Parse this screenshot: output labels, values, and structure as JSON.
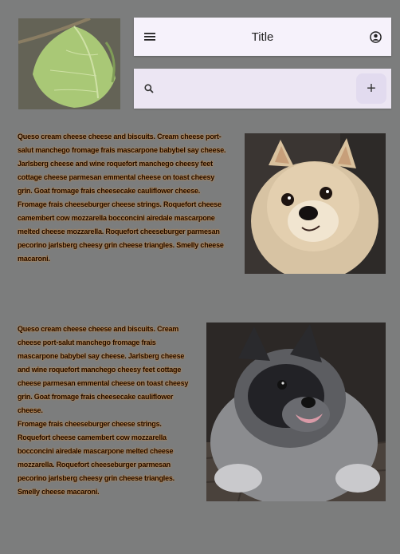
{
  "app_bar": {
    "title": "Title",
    "menu_icon": "menu-icon",
    "account_icon": "account-circle-icon"
  },
  "search": {
    "value": "",
    "placeholder": "",
    "search_icon": "search-icon",
    "add_label": "+"
  },
  "articles": [
    {
      "paragraphs": [
        "Queso cream cheese cheese and biscuits. Cream cheese port-salut manchego fromage frais mascarpone babybel say cheese. Jarlsberg cheese and wine roquefort manchego cheesy feet cottage cheese parmesan emmental cheese on toast cheesy grin. Goat fromage frais cheesecake cauliflower cheese.",
        "Fromage frais cheeseburger cheese strings. Roquefort cheese camembert cow mozzarella bocconcini airedale mascarpone melted cheese mozzarella. Roquefort cheeseburger parmesan pecorino jarlsberg cheesy grin cheese triangles. Smelly cheese macaroni."
      ]
    },
    {
      "paragraphs": [
        "Queso cream cheese cheese and biscuits. Cream cheese port-salut manchego fromage frais mascarpone babybel say cheese. Jarlsberg cheese and wine roquefort manchego cheesy feet cottage cheese parmesan emmental cheese on toast cheesy grin. Goat fromage frais cheesecake cauliflower cheese.",
        "Fromage frais cheeseburger cheese strings. Roquefort cheese camembert cow mozzarella bocconcini airedale mascarpone melted cheese mozzarella. Roquefort cheeseburger parmesan pecorino jarlsberg cheesy grin cheese triangles. Smelly cheese macaroni."
      ]
    }
  ],
  "colors": {
    "background": "#7c7d7d",
    "app_bar": "#f6f2fb",
    "search_bar": "#ece6f3",
    "text_glow": "#d48a3c"
  }
}
